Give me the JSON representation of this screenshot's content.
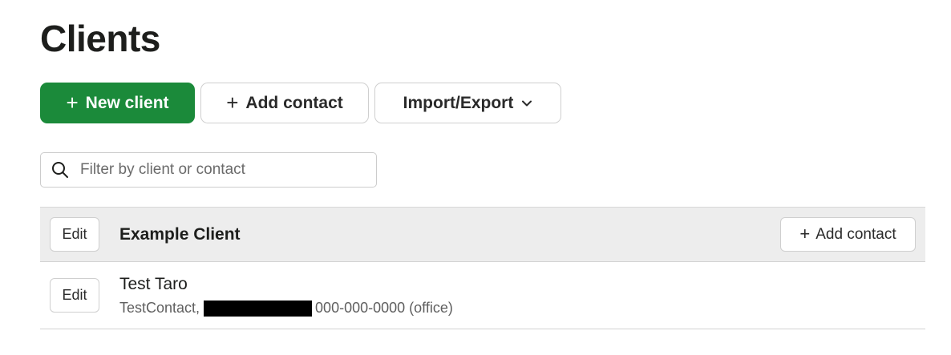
{
  "page": {
    "title": "Clients"
  },
  "toolbar": {
    "new_client_label": "New client",
    "add_contact_label": "Add contact",
    "import_export_label": "Import/Export",
    "primary_color": "#1b8a3a"
  },
  "filter": {
    "placeholder": "Filter by client or contact",
    "value": ""
  },
  "clients": [
    {
      "name": "Example Client",
      "edit_label": "Edit",
      "add_contact_label": "Add contact",
      "contacts": [
        {
          "name": "Test Taro",
          "edit_label": "Edit",
          "title": "TestContact,",
          "phone": "000-000-0000 (office)"
        }
      ]
    }
  ],
  "icons": {
    "plus": "plus-icon",
    "chevron": "chevron-down-icon",
    "search": "search-icon"
  }
}
